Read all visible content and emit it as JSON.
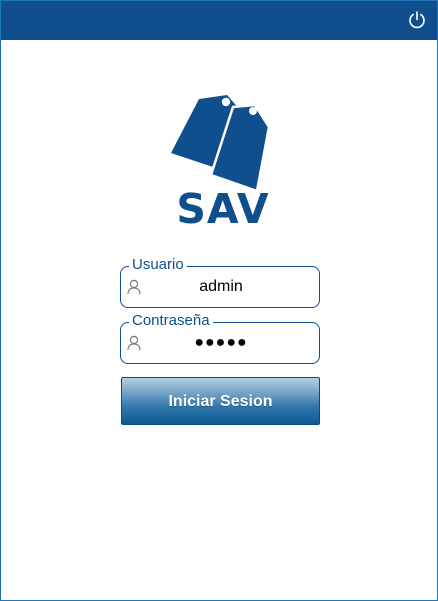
{
  "app": {
    "logo_text": "SAV",
    "logo_icon": "price-tags-icon"
  },
  "titlebar": {
    "power_icon": "power-icon"
  },
  "form": {
    "user": {
      "label": "Usuario",
      "value": "admin",
      "icon": "user-icon"
    },
    "password": {
      "label": "Contraseña",
      "value": "●●●●●",
      "icon": "user-icon"
    },
    "submit_label": "Iniciar Sesion"
  },
  "colors": {
    "brand": "#0f4f8e",
    "border": "#1e78b8",
    "background": "#ffffff"
  }
}
